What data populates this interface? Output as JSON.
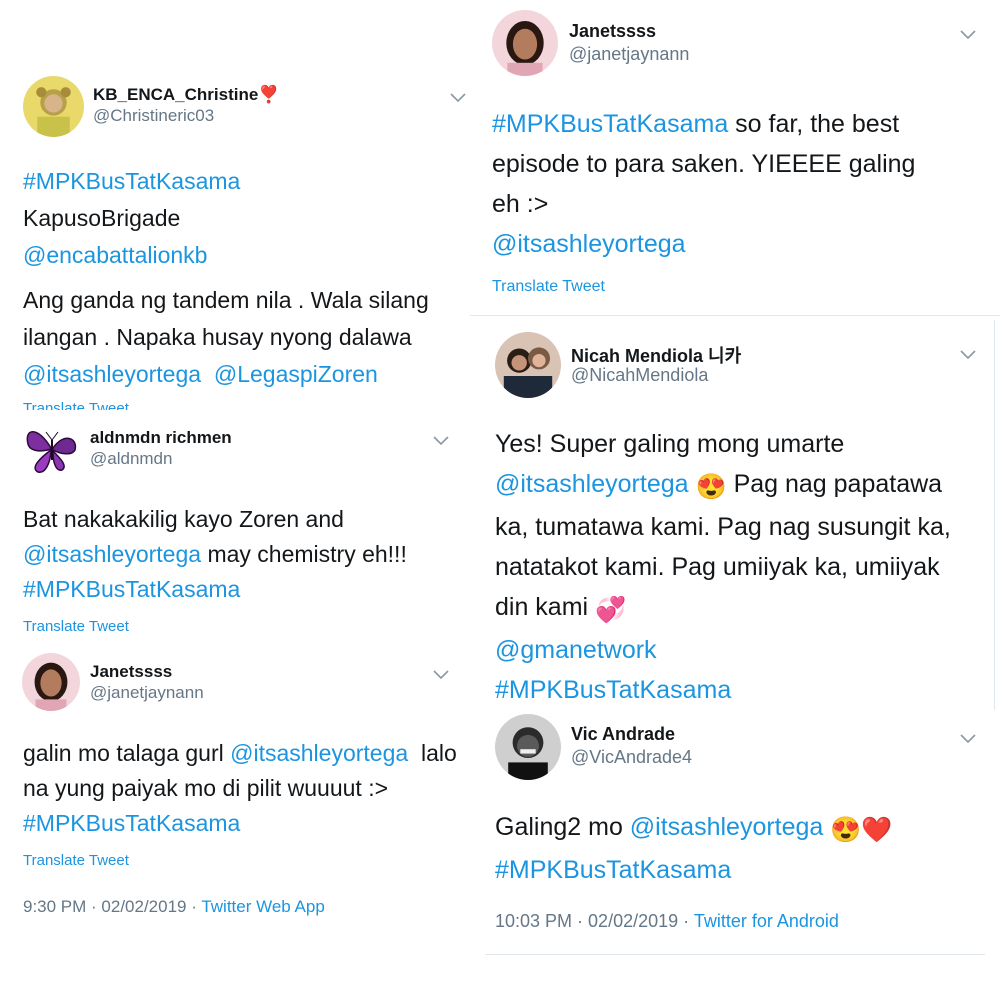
{
  "tweets": {
    "christine": {
      "name": "KB_ENCA_Christine",
      "name_emoji": "❣️",
      "handle": "@Christineric03",
      "lines": [
        [
          {
            "t": "#MPKBusTatKasama",
            "link": true
          }
        ],
        [
          {
            "t": "KapusoBrigade",
            "link": false
          }
        ],
        [
          {
            "t": "@encabattalionkb",
            "link": true
          }
        ]
      ],
      "body": [
        [
          {
            "t": "Ang ganda ng tandem nila . Wala silang",
            "link": false
          }
        ],
        [
          {
            "t": "ilangan . Napaka husay nyong dalawa",
            "link": false
          }
        ],
        [
          {
            "t": "@itsashleyortega",
            "link": true
          },
          {
            "t": "  ",
            "link": false
          },
          {
            "t": "@LegaspiZoren",
            "link": true
          }
        ]
      ],
      "translate": "Translate Tweet"
    },
    "aldn": {
      "name": "aldnmdn richmen",
      "handle": "@aldnmdn",
      "body": [
        [
          {
            "t": "Bat nakakakilig kayo Zoren and",
            "link": false
          }
        ],
        [
          {
            "t": "@itsashleyortega",
            "link": true
          },
          {
            "t": " may chemistry eh!!!",
            "link": false
          }
        ],
        [
          {
            "t": "#MPKBusTatKasama",
            "link": true
          }
        ]
      ],
      "translate": "Translate Tweet"
    },
    "janet_left": {
      "name": "Janetssss",
      "handle": "@janetjaynann",
      "body": [
        [
          {
            "t": "galin mo talaga gurl ",
            "link": false
          },
          {
            "t": "@itsashleyortega",
            "link": true
          },
          {
            "t": "  lalo",
            "link": false
          }
        ],
        [
          {
            "t": "na yung paiyak mo di pilit wuuuut :>",
            "link": false
          }
        ],
        [
          {
            "t": "#MPKBusTatKasama",
            "link": true
          }
        ]
      ],
      "translate": "Translate Tweet",
      "time": "9:30 PM · 02/02/2019 · ",
      "via": "Twitter Web App"
    },
    "janet_right": {
      "name": "Janetssss",
      "handle": "@janetjaynann",
      "body": [
        [
          {
            "t": "#MPKBusTatKasama",
            "link": true
          },
          {
            "t": " so far, the best",
            "link": false
          }
        ],
        [
          {
            "t": "episode to para saken. YIEEEE galing",
            "link": false
          }
        ],
        [
          {
            "t": "eh :>",
            "link": false
          }
        ],
        [
          {
            "t": "@itsashleyortega",
            "link": true
          }
        ]
      ],
      "translate": "Translate Tweet"
    },
    "nicah": {
      "name": "Nicah Mendiola 니카",
      "handle": "@NicahMendiola",
      "body": [
        [
          {
            "t": "Yes! Super galing mong umarte",
            "link": false
          }
        ],
        [
          {
            "t": "@itsashleyortega",
            "link": true
          },
          {
            "t": " ",
            "link": false
          },
          {
            "t": "😍",
            "emoji": true
          },
          {
            "t": " Pag nag papatawa",
            "link": false
          }
        ],
        [
          {
            "t": "ka, tumatawa kami. Pag nag susungit ka,",
            "link": false
          }
        ],
        [
          {
            "t": "natatakot kami. Pag umiiyak ka, umiiyak",
            "link": false
          }
        ],
        [
          {
            "t": "din kami ",
            "link": false
          },
          {
            "t": "💞",
            "emoji": true
          }
        ],
        [
          {
            "t": "@gmanetwork",
            "link": true
          }
        ],
        [
          {
            "t": "#MPKBusTatKasama",
            "link": true
          }
        ]
      ]
    },
    "vic": {
      "name": "Vic Andrade",
      "handle": "@VicAndrade4",
      "body": [
        [
          {
            "t": "Galing2 mo ",
            "link": false
          },
          {
            "t": "@itsashleyortega",
            "link": true
          },
          {
            "t": " ",
            "link": false
          },
          {
            "t": "😍❤️",
            "emoji": true
          }
        ],
        [
          {
            "t": "#MPKBusTatKasama",
            "link": true
          }
        ]
      ],
      "time": "10:03 PM · 02/02/2019 · ",
      "via": "Twitter for Android"
    }
  },
  "colors": {
    "link": "#1b95e0",
    "secondary": "#657786",
    "text": "#14171a",
    "divider": "#e1e8ed"
  },
  "icons": {
    "chevron": "chevron-down-icon"
  }
}
